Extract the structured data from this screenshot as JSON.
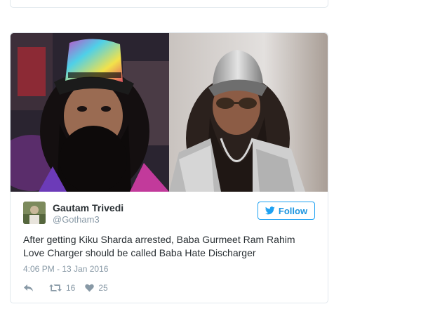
{
  "tweet": {
    "author": {
      "display_name": "Gautam Trivedi",
      "handle": "@Gotham3",
      "avatar_icon": "avatar-photo"
    },
    "follow_button": {
      "label": "Follow",
      "icon": "twitter-bird-icon",
      "color": "#1da1f2"
    },
    "text": "After getting Kiku Sharda arrested, Baba Gurmeet Ram Rahim Love Charger should be called Baba Hate Discharger",
    "timestamp": "4:06 PM - 13 Jan 2016",
    "actions": {
      "reply_icon": "reply-icon",
      "retweet_icon": "retweet-icon",
      "retweet_count": "16",
      "like_icon": "heart-icon",
      "like_count": "25"
    },
    "media": {
      "photos": [
        "left-photo",
        "right-photo"
      ]
    }
  }
}
